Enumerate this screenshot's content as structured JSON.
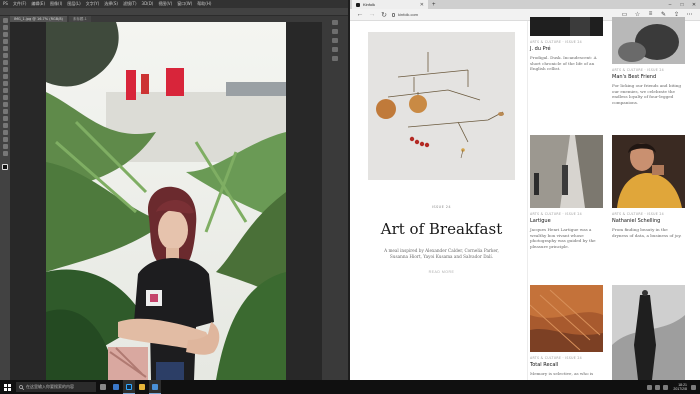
{
  "photoshop": {
    "menu": [
      "PS",
      "文件(F)",
      "编辑(E)",
      "图像(I)",
      "图层(L)",
      "文字(Y)",
      "选择(S)",
      "滤镜(T)",
      "3D(D)",
      "视图(V)",
      "窗口(W)",
      "帮助(H)"
    ],
    "tabs": [
      "IMG_1.jpg @ 16.7% (RGB/8)",
      "未标题-1"
    ]
  },
  "browser": {
    "tab_title": "Kinfolk",
    "url": "kinfolk.com",
    "feature": {
      "meta": "ISSUE 24",
      "title": "Art of Breakfast",
      "description": "A meal inspired by Alexander Calder, Cornelia Parker, Susanna Hiort, Yayoi Kusama and Salvador Dalí.",
      "read_more": "READ MORE"
    },
    "cards": [
      {
        "cat": "ARTS & CULTURE · ISSUE 24",
        "title": "J. du Pré",
        "desc": "Prodigal. Dusk. Incandescent: A short chronicle of the life of an English cellist."
      },
      {
        "cat": "ARTS & CULTURE · ISSUE 24",
        "title": "Man's Best Friend",
        "desc": "For licking our friends and biting our enemies, we celebrate the endless loyalty of four-legged companions."
      },
      {
        "cat": "ARTS & CULTURE · ISSUE 24",
        "title": "Lartigue",
        "desc": "Jacques Henri Lartigue was a wealthy bon vivant whose photography was guided by the pleasure principle."
      },
      {
        "cat": "ARTS & CULTURE · ISSUE 24",
        "title": "Nathaniel Schelling",
        "desc": "From finding beauty in the dryness of data, a business of joy."
      },
      {
        "cat": "ARTS & CULTURE · ISSUE 24",
        "title": "Total Recall",
        "desc": "Memory is selective, as who is"
      }
    ]
  },
  "taskbar": {
    "search_placeholder": "在这里输入你要搜索的内容",
    "time": "18:21",
    "date": "2017/2/8"
  }
}
